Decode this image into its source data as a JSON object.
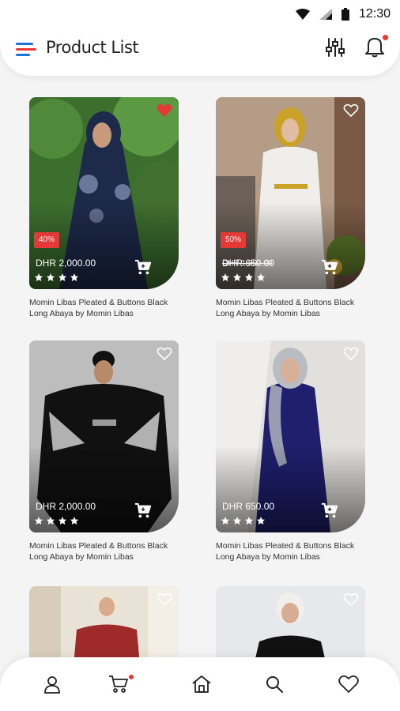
{
  "status_bar": {
    "time": "12:30",
    "icons": [
      "wifi-icon",
      "signal-icon",
      "battery-icon"
    ]
  },
  "header": {
    "title": "Product List",
    "icons": [
      "menu-icon",
      "filter-icon",
      "bell-icon"
    ]
  },
  "colors": {
    "accent_blue": "#1e73d8",
    "accent_red": "#e53935",
    "heart_red": "#e53935",
    "discount_bg": "#e53935",
    "notification_dot": "#e53935"
  },
  "products": [
    {
      "name": "Momin Libas Pleated & Buttons Black Long Abaya by Momin Libas",
      "price": "DHR 2,000.00",
      "old_price": "",
      "discount": "40%",
      "favorite": true,
      "rating": 4
    },
    {
      "name": "Momin Libas Pleated & Buttons Black Long Abaya by Momin Libas",
      "price": "DHR 650.00",
      "old_price": "DHR 1,300.00",
      "discount": "50%",
      "favorite": false,
      "rating": 4
    },
    {
      "name": "Momin Libas Pleated & Buttons Black Long Abaya by Momin Libas",
      "price": "DHR 2,000.00",
      "old_price": "",
      "discount": "",
      "favorite": false,
      "rating": 4
    },
    {
      "name": "Momin Libas Pleated & Buttons Black Long Abaya by Momin Libas",
      "price": "DHR 650.00",
      "old_price": "",
      "discount": "",
      "favorite": false,
      "rating": 4
    },
    {
      "name": "",
      "price": "",
      "old_price": "",
      "discount": "",
      "favorite": false,
      "rating": 0
    },
    {
      "name": "",
      "price": "",
      "old_price": "",
      "discount": "",
      "favorite": false,
      "rating": 0
    }
  ],
  "bottom_nav": {
    "items": [
      "profile-icon",
      "cart-icon",
      "home-icon",
      "search-icon",
      "heart-icon"
    ],
    "cart_has_badge": true
  }
}
